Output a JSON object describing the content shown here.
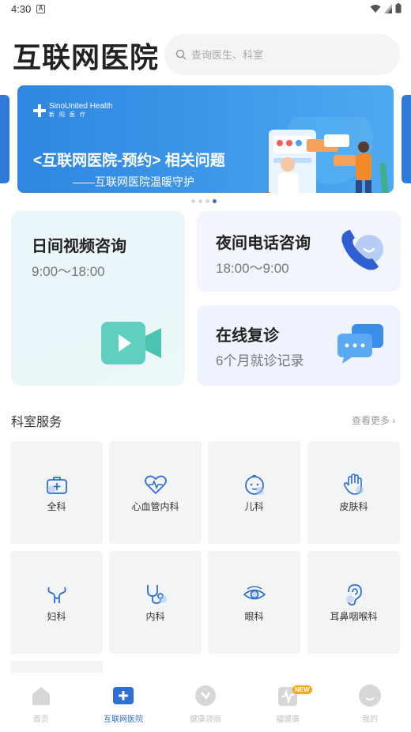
{
  "status_bar": {
    "time": "4:30",
    "notification_letter": "A"
  },
  "header": {
    "title": "互联网医院",
    "search_placeholder": "查询医生、科室"
  },
  "banner": {
    "logo_text": "SinoUnited Health",
    "logo_sub": "新阳医疗",
    "title": "<互联网医院-预约> 相关问题",
    "subtitle": "——互联网医院温暖守护",
    "slides": 4,
    "active_slide": 4
  },
  "consult": {
    "video": {
      "title": "日间视频咨询",
      "hours": "9:00～18:00"
    },
    "night": {
      "title": "夜间电话咨询",
      "hours": "18:00～9:00"
    },
    "revisit": {
      "title": "在线复诊",
      "subtitle": "6个月就诊记录"
    }
  },
  "departments": {
    "section_title": "科室服务",
    "more_label": "查看更多 ›",
    "items": [
      {
        "label": "全科",
        "icon": "medical-kit-icon"
      },
      {
        "label": "心血管内科",
        "icon": "heart-pulse-icon"
      },
      {
        "label": "儿科",
        "icon": "baby-face-icon"
      },
      {
        "label": "皮肤科",
        "icon": "hand-icon"
      },
      {
        "label": "妇科",
        "icon": "uterus-icon"
      },
      {
        "label": "内科",
        "icon": "stethoscope-icon"
      },
      {
        "label": "眼科",
        "icon": "eye-icon"
      },
      {
        "label": "耳鼻咽喉科",
        "icon": "ear-icon"
      }
    ]
  },
  "tab_bar": {
    "items": [
      {
        "label": "首页",
        "icon": "home-icon"
      },
      {
        "label": "互联网医院",
        "icon": "medical-cross-icon"
      },
      {
        "label": "健康领商",
        "icon": "health-icon"
      },
      {
        "label": "福健康",
        "icon": "gift-icon"
      },
      {
        "label": "我的",
        "icon": "profile-icon"
      }
    ],
    "active_index": 1,
    "new_badge": "NEW"
  },
  "colors": {
    "accent": "#2d6fd2",
    "banner": "#3f98ea",
    "video_icon": "#5fd0c0"
  }
}
